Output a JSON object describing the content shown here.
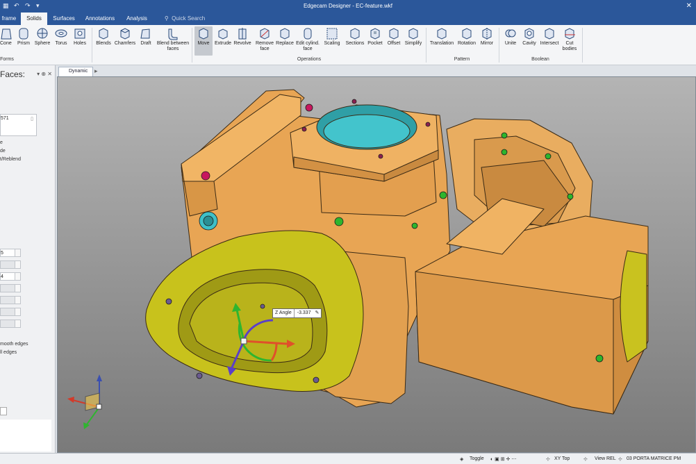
{
  "window": {
    "title": "Edgecam Designer - EC-feature.wkf"
  },
  "tabs": [
    "frame",
    "Solids",
    "Surfaces",
    "Annotations",
    "Analysis"
  ],
  "active_tab": "Solids",
  "search": {
    "label": "Quick Search"
  },
  "ribbon": {
    "forms": {
      "label": "Forms",
      "buttons": [
        "Cone",
        "Prism",
        "Sphere",
        "Torus",
        "Holes"
      ]
    },
    "edit": {
      "buttons": [
        "Blends",
        "Chamfers",
        "Draft",
        "Blend between faces"
      ]
    },
    "operations": {
      "label": "Operations",
      "buttons": [
        "Move",
        "Extrude",
        "Revolve",
        "Remove face",
        "Replace",
        "Edit cylind. face",
        "Scaling",
        "Sections",
        "Pocket",
        "Offset",
        "Simplify"
      ]
    },
    "pattern": {
      "label": "Pattern",
      "buttons": [
        "Translation",
        "Rotation",
        "Mirror"
      ]
    },
    "boolean": {
      "label": "Boolean",
      "buttons": [
        "Unite",
        "Cavity",
        "Intersect",
        "Cut bodies"
      ]
    },
    "selected": "Move"
  },
  "panel": {
    "title": "Faces:",
    "list_value": "571",
    "options": [
      "e",
      "de",
      "t/Reblend"
    ],
    "checkboxes": [
      "mooth edges",
      "ll edges"
    ],
    "spin_values": [
      "5",
      "",
      "4",
      "",
      "",
      ""
    ]
  },
  "doc_tab": {
    "label": "Dynamic"
  },
  "tooltip": {
    "label": "Z Angle",
    "value": "-3.337"
  },
  "status": {
    "toggle": "Toggle",
    "plane": "XY Top",
    "view": "View REL",
    "machine": "03 PORTA MATRICE PM"
  },
  "colors": {
    "part": "#e8a554",
    "flange": "#c8c21c",
    "hole_green": "#2db52d",
    "hole_magenta": "#c8175e",
    "bore_cyan": "#3ec0c7",
    "axis_x": "#e0502a",
    "axis_y": "#2fb52f",
    "axis_z": "#5b3fc8"
  }
}
